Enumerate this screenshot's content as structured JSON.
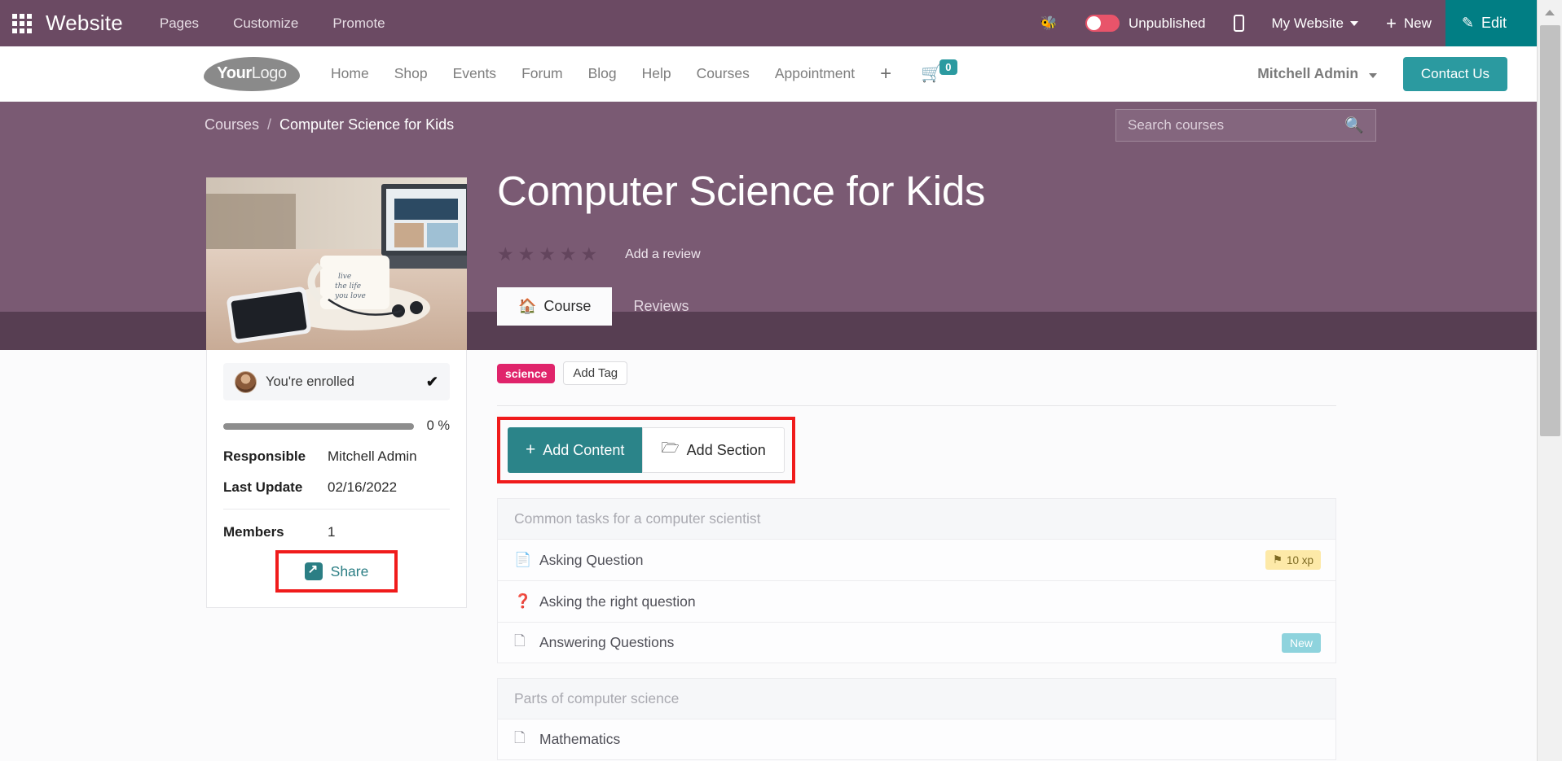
{
  "odoo_bar": {
    "apps_icon": "apps-grid-icon",
    "brand": "Website",
    "menus": [
      "Pages",
      "Customize",
      "Promote"
    ],
    "bug_icon": "bug-icon",
    "publish_state": "Unpublished",
    "mobile_icon": "mobile-preview-icon",
    "website_selector": "My Website",
    "new_label": "New",
    "edit_label": "Edit",
    "accent_teal": "#017e84",
    "bar_purple": "#6b4a63",
    "toggle_red": "#e8546a"
  },
  "site_header": {
    "logo_bold": "Your",
    "logo_light": "Logo",
    "nav": [
      "Home",
      "Shop",
      "Events",
      "Forum",
      "Blog",
      "Help",
      "Courses",
      "Appointment"
    ],
    "plus_label": "+",
    "cart_icon": "shopping-cart-icon",
    "cart_count": "0",
    "user": "Mitchell Admin",
    "contact_label": "Contact Us"
  },
  "breadcrumb": {
    "root": "Courses",
    "separator": "/",
    "current": "Computer Science for Kids",
    "search_placeholder": "Search courses",
    "search_icon": "search-icon"
  },
  "course": {
    "title": "Computer Science for Kids",
    "stars": [
      "star",
      "star",
      "star",
      "star",
      "star"
    ],
    "add_review": "Add a review",
    "tabs": [
      {
        "label": "Course",
        "icon": "home-icon",
        "active": true
      },
      {
        "label": "Reviews",
        "icon": "",
        "active": false
      }
    ],
    "tags": {
      "science": "science",
      "add_tag": "Add Tag",
      "tag_color": "#e0246b"
    },
    "toolbar": {
      "add_content": "Add Content",
      "add_content_icon": "plus-icon",
      "add_section": "Add Section",
      "add_section_icon": "folder-icon",
      "highlight_color": "#f01b1b"
    }
  },
  "sidebar": {
    "thumbnail_alt": "laptop-coffee-phone-photo",
    "enrolled_text": "You're enrolled",
    "enrolled_check": "✔",
    "avatar": "user-avatar",
    "progress_label": "0 %",
    "progress_percent": 0,
    "info": [
      {
        "key": "Responsible",
        "value": "Mitchell Admin"
      },
      {
        "key": "Last Update",
        "value": "02/16/2022"
      },
      {
        "key": "Members",
        "value": "1"
      }
    ],
    "share": {
      "label": "Share",
      "icon": "share-icon",
      "icon_color": "#2b7e84"
    }
  },
  "content": {
    "sections": [
      {
        "heading": "Common tasks for a computer scientist",
        "items": [
          {
            "icon": "document-icon",
            "label": "Asking Question",
            "badge": "10 xp",
            "badge_type": "xp",
            "badge_icon": "flag-icon"
          },
          {
            "icon": "question-circle-icon",
            "label": "Asking the right question",
            "badge": "",
            "badge_type": ""
          },
          {
            "icon": "pdf-file-icon",
            "label": "Answering Questions",
            "badge": "New",
            "badge_type": "new"
          }
        ]
      },
      {
        "heading": "Parts of computer science",
        "items": [
          {
            "icon": "pdf-file-icon",
            "label": "Mathematics",
            "badge": "",
            "badge_type": ""
          }
        ]
      }
    ],
    "badge_xp_color": "#fde9a8",
    "badge_new_color": "#8ed3dd"
  },
  "scrollbar": {
    "up_arrow": "scroll-up-arrow-icon"
  }
}
